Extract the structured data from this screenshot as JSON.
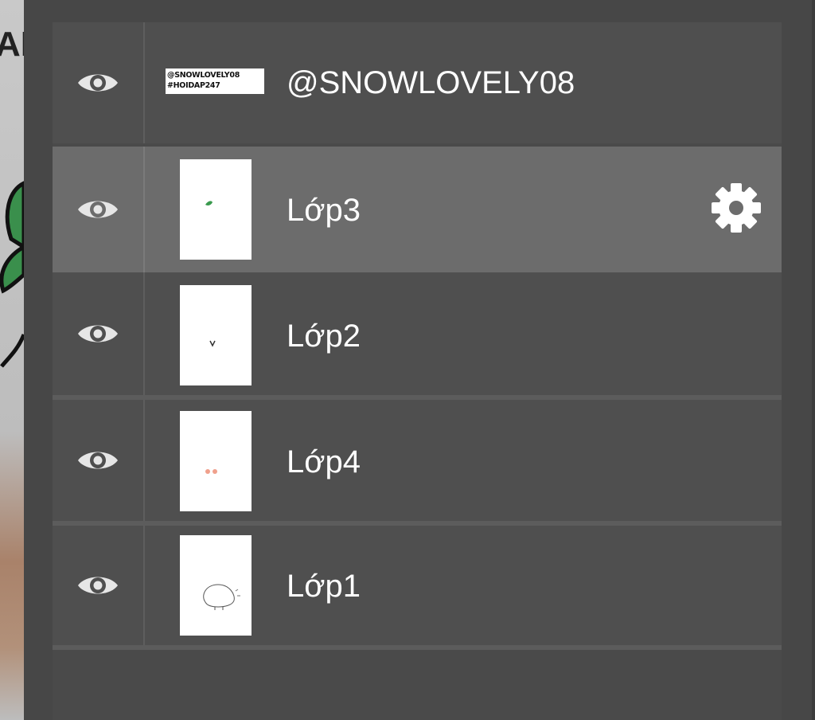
{
  "canvas": {
    "accent_green": "#3a8f4c",
    "edge_text": "AP"
  },
  "layers": [
    {
      "name": "@SNOWLOVELY08",
      "thumbnail_text": [
        "@SNOWLOVELY08",
        "#HOIDAP247"
      ],
      "visible": true,
      "selected": false,
      "visibility_icon": "eye-icon"
    },
    {
      "name": "Lớp3",
      "visible": true,
      "selected": true,
      "visibility_icon": "eye-icon",
      "settings_icon": "gear-icon"
    },
    {
      "name": "Lớp2",
      "visible": true,
      "selected": false,
      "visibility_icon": "eye-icon"
    },
    {
      "name": "Lớp4",
      "visible": true,
      "selected": false,
      "visibility_icon": "eye-icon"
    },
    {
      "name": "Lớp1",
      "visible": true,
      "selected": false,
      "visibility_icon": "eye-icon"
    }
  ],
  "colors": {
    "panel_bg": "#474747",
    "row_bg": "#4f4f4f",
    "selected_row_bg": "#6c6c6c",
    "text": "#ffffff",
    "icon": "#e6e6e6"
  }
}
